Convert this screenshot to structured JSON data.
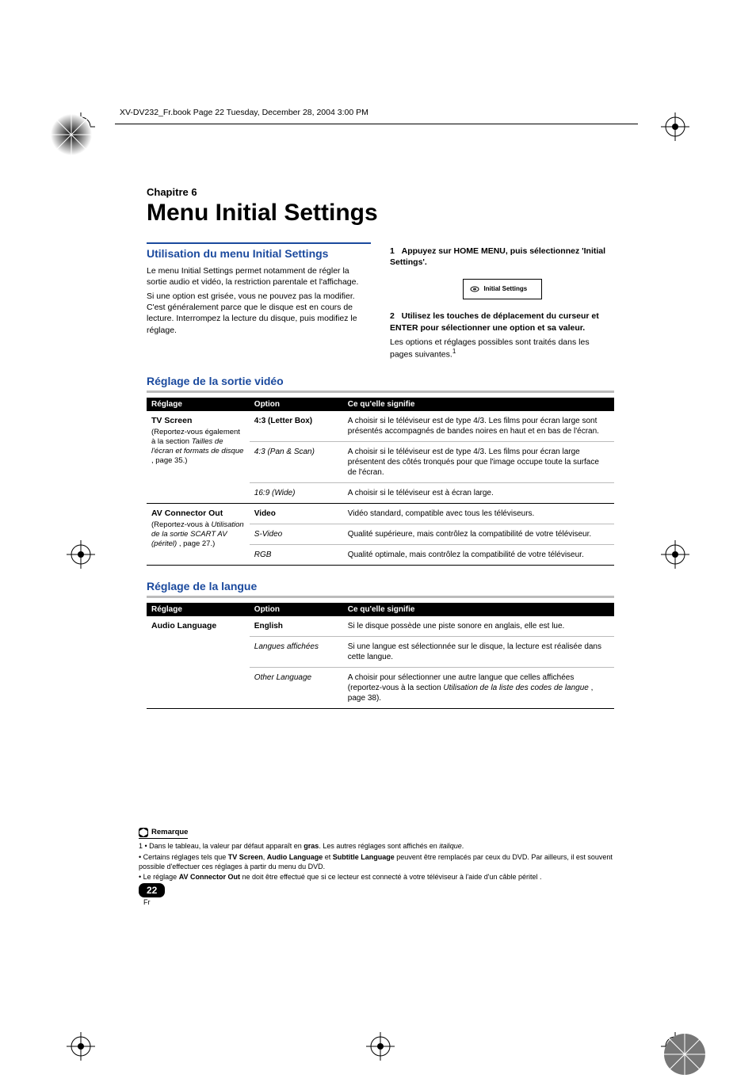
{
  "header_meta": "XV-DV232_Fr.book  Page 22  Tuesday, December 28, 2004  3:00 PM",
  "chapter_label": "Chapitre 6",
  "main_title": "Menu Initial Settings",
  "left_col": {
    "section_title": "Utilisation du menu Initial Settings",
    "para1": "Le menu Initial Settings permet notamment de régler la sortie audio et vidéo, la restriction parentale et l'affichage.",
    "para2": "Si une option est grisée, vous ne pouvez pas la modifier. C'est généralement parce que le disque est en cours de lecture. Interrompez la lecture du disque, puis modifiez le réglage."
  },
  "right_col": {
    "step1_num": "1",
    "step1_text": "Appuyez sur HOME MENU, puis sélectionnez 'Initial Settings'.",
    "icon_label": "Initial Settings",
    "step2_num": "2",
    "step2_text": "Utilisez les touches de déplacement du curseur et ENTER pour sélectionner une option et sa valeur.",
    "para3a": "Les options et réglages possibles sont traités dans les pages suivantes.",
    "para3_sup": "1"
  },
  "video_section": {
    "heading": "Réglage de la sortie vidéo",
    "headers": {
      "c1": "Réglage",
      "c2": "Option",
      "c3": "Ce qu'elle signifie"
    },
    "group1_label": "TV Screen",
    "group1_sub1": "(Reportez-vous également à la section ",
    "group1_sub_em": "Tailles de l'écran et formats de disque",
    "group1_sub2": " , page 35.)",
    "rows1": [
      {
        "opt": "4:3 (Letter Box)",
        "bold": true,
        "desc": "A choisir si le téléviseur est de type 4/3. Les films pour écran large sont présentés accompagnés de bandes noires en haut et en bas de l'écran."
      },
      {
        "opt": "4:3 (Pan & Scan)",
        "bold": false,
        "desc": "A choisir si le téléviseur est de type 4/3. Les films pour écran large présentent des côtés tronqués pour que l'image occupe toute la surface de l'écran."
      },
      {
        "opt": "16:9 (Wide)",
        "bold": false,
        "desc": "A choisir si le téléviseur est à écran large."
      }
    ],
    "group2_label": "AV Connector Out",
    "group2_sub1": "(Reportez-vous à ",
    "group2_sub_em": "Utilisation de la sortie SCART AV (péritel)",
    "group2_sub2": " , page 27.)",
    "rows2": [
      {
        "opt": "Video",
        "bold": true,
        "desc": "Vidéo standard, compatible avec tous les téléviseurs."
      },
      {
        "opt": "S-Video",
        "bold": false,
        "desc": "Qualité supérieure, mais contrôlez la compatibilité de votre téléviseur."
      },
      {
        "opt": "RGB",
        "bold": false,
        "desc": "Qualité optimale, mais contrôlez la compatibilité de votre téléviseur."
      }
    ]
  },
  "lang_section": {
    "heading": "Réglage de la langue",
    "headers": {
      "c1": "Réglage",
      "c2": "Option",
      "c3": "Ce qu'elle signifie"
    },
    "group_label": "Audio Language",
    "rows": [
      {
        "opt": "English",
        "bold": true,
        "desc": "Si le disque possède une piste sonore en anglais, elle est lue."
      },
      {
        "opt": "Langues affichées",
        "bold": false,
        "desc": "Si une langue est sélectionnée sur le disque, la lecture est réalisée dans cette langue."
      },
      {
        "opt": "Other Language",
        "bold": false,
        "desc_pre": "A choisir pour sélectionner une autre langue que celles affichées (reportez-vous à la section ",
        "desc_em": "Utilisation de la liste des codes de langue",
        "desc_post": " , page 38)."
      }
    ]
  },
  "footnote": {
    "label": "Remarque",
    "line1_pre": "1 • Dans le tableau, la valeur par défaut apparaît en ",
    "line1_bold": "gras",
    "line1_mid": ". Les autres réglages sont affichés en ",
    "line1_em": "italique",
    "line1_post": ".",
    "line2_pre": "• Certains réglages tels que ",
    "line2_b1": "TV Screen",
    "line2_sep1": ", ",
    "line2_b2": "Audio Language",
    "line2_sep2": " et ",
    "line2_b3": "Subtitle Language",
    "line2_post": " peuvent être remplacés par ceux du DVD. Par ailleurs, il est souvent possible d'effectuer ces réglages à partir du menu du DVD.",
    "line3_pre": "• Le réglage ",
    "line3_b": "AV Connector Out",
    "line3_post": " ne doit être effectué que si ce lecteur est connecté à votre téléviseur à l'aide d'un câble péritel ."
  },
  "page_number": "22",
  "page_lang": "Fr"
}
